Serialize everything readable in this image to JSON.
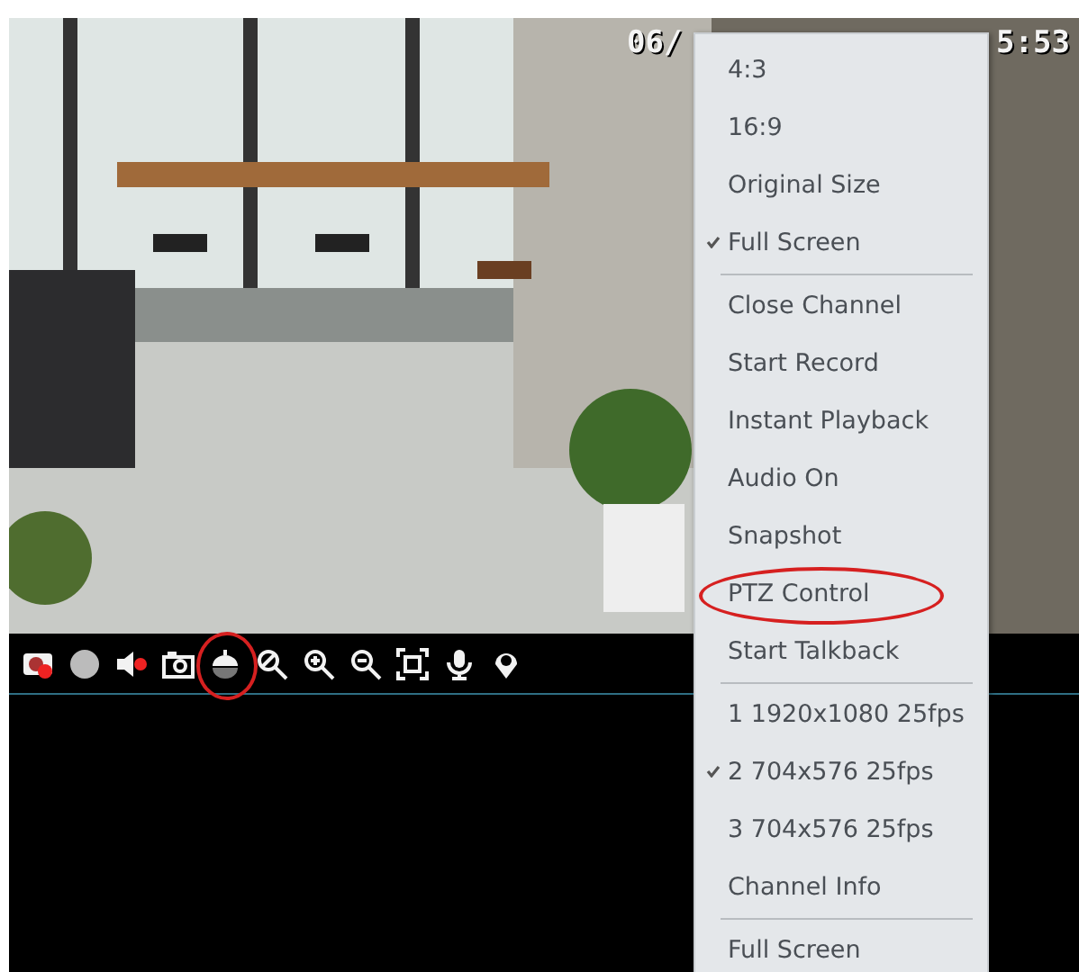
{
  "video": {
    "overlay_texts": [
      "06/",
      "5:53"
    ]
  },
  "toolbar": [
    {
      "kind": "disable",
      "circled": false
    },
    {
      "kind": "record",
      "circled": false
    },
    {
      "kind": "mute",
      "circled": false
    },
    {
      "kind": "camera",
      "circled": false
    },
    {
      "kind": "ptz",
      "circled": true
    },
    {
      "kind": "zoom-off",
      "circled": false
    },
    {
      "kind": "zoom-in",
      "circled": false
    },
    {
      "kind": "zoom-out",
      "circled": false
    },
    {
      "kind": "fit",
      "circled": false
    },
    {
      "kind": "mic",
      "circled": false
    },
    {
      "kind": "location",
      "circled": false
    }
  ],
  "menu": [
    [
      {
        "label": "4:3",
        "checked": false,
        "circled": false
      },
      {
        "label": "16:9",
        "checked": false,
        "circled": false
      },
      {
        "label": "Original Size",
        "checked": false,
        "circled": false
      },
      {
        "label": "Full Screen",
        "checked": true,
        "circled": false
      }
    ],
    [
      {
        "label": "Close Channel",
        "checked": false,
        "circled": false
      },
      {
        "label": "Start Record",
        "checked": false,
        "circled": false
      },
      {
        "label": "Instant Playback",
        "checked": false,
        "circled": false
      },
      {
        "label": "Audio On",
        "checked": false,
        "circled": false
      },
      {
        "label": "Snapshot",
        "checked": false,
        "circled": false
      },
      {
        "label": "PTZ Control",
        "checked": false,
        "circled": true
      },
      {
        "label": "Start Talkback",
        "checked": false,
        "circled": false
      }
    ],
    [
      {
        "label": "1 1920x1080 25fps",
        "checked": false,
        "circled": false
      },
      {
        "label": "2 704x576 25fps",
        "checked": true,
        "circled": false
      },
      {
        "label": "3 704x576 25fps",
        "checked": false,
        "circled": false
      },
      {
        "label": "Channel Info",
        "checked": false,
        "circled": false
      }
    ],
    [
      {
        "label": "Full Screen",
        "checked": false,
        "circled": false
      }
    ]
  ]
}
